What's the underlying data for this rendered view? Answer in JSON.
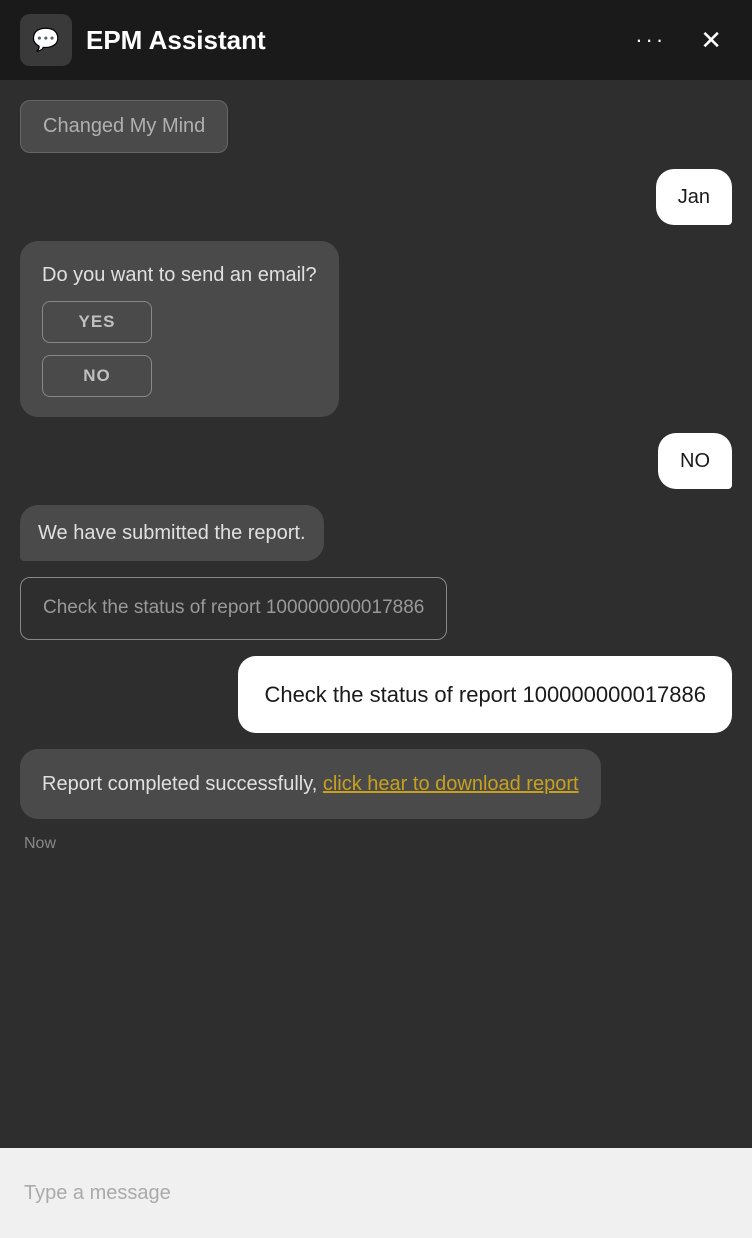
{
  "header": {
    "icon": "💬",
    "title": "EPM Assistant",
    "more_label": "···",
    "close_label": "✕"
  },
  "chat": {
    "changed_mind_btn": "Changed My Mind",
    "user_msg_jan": "Jan",
    "email_question": "Do you want to send an email?",
    "yes_label": "YES",
    "no_label": "NO",
    "user_msg_no": "NO",
    "submitted_msg": "We have submitted the report.",
    "status_check_outlined": "Check the status of report 100000000017886",
    "status_check_white": "Check the status of report 100000000017886",
    "report_completed_prefix": "Report completed successfully, ",
    "report_link_text": "click hear to download report",
    "timestamp": "Now"
  },
  "input": {
    "placeholder": "Type a message"
  }
}
